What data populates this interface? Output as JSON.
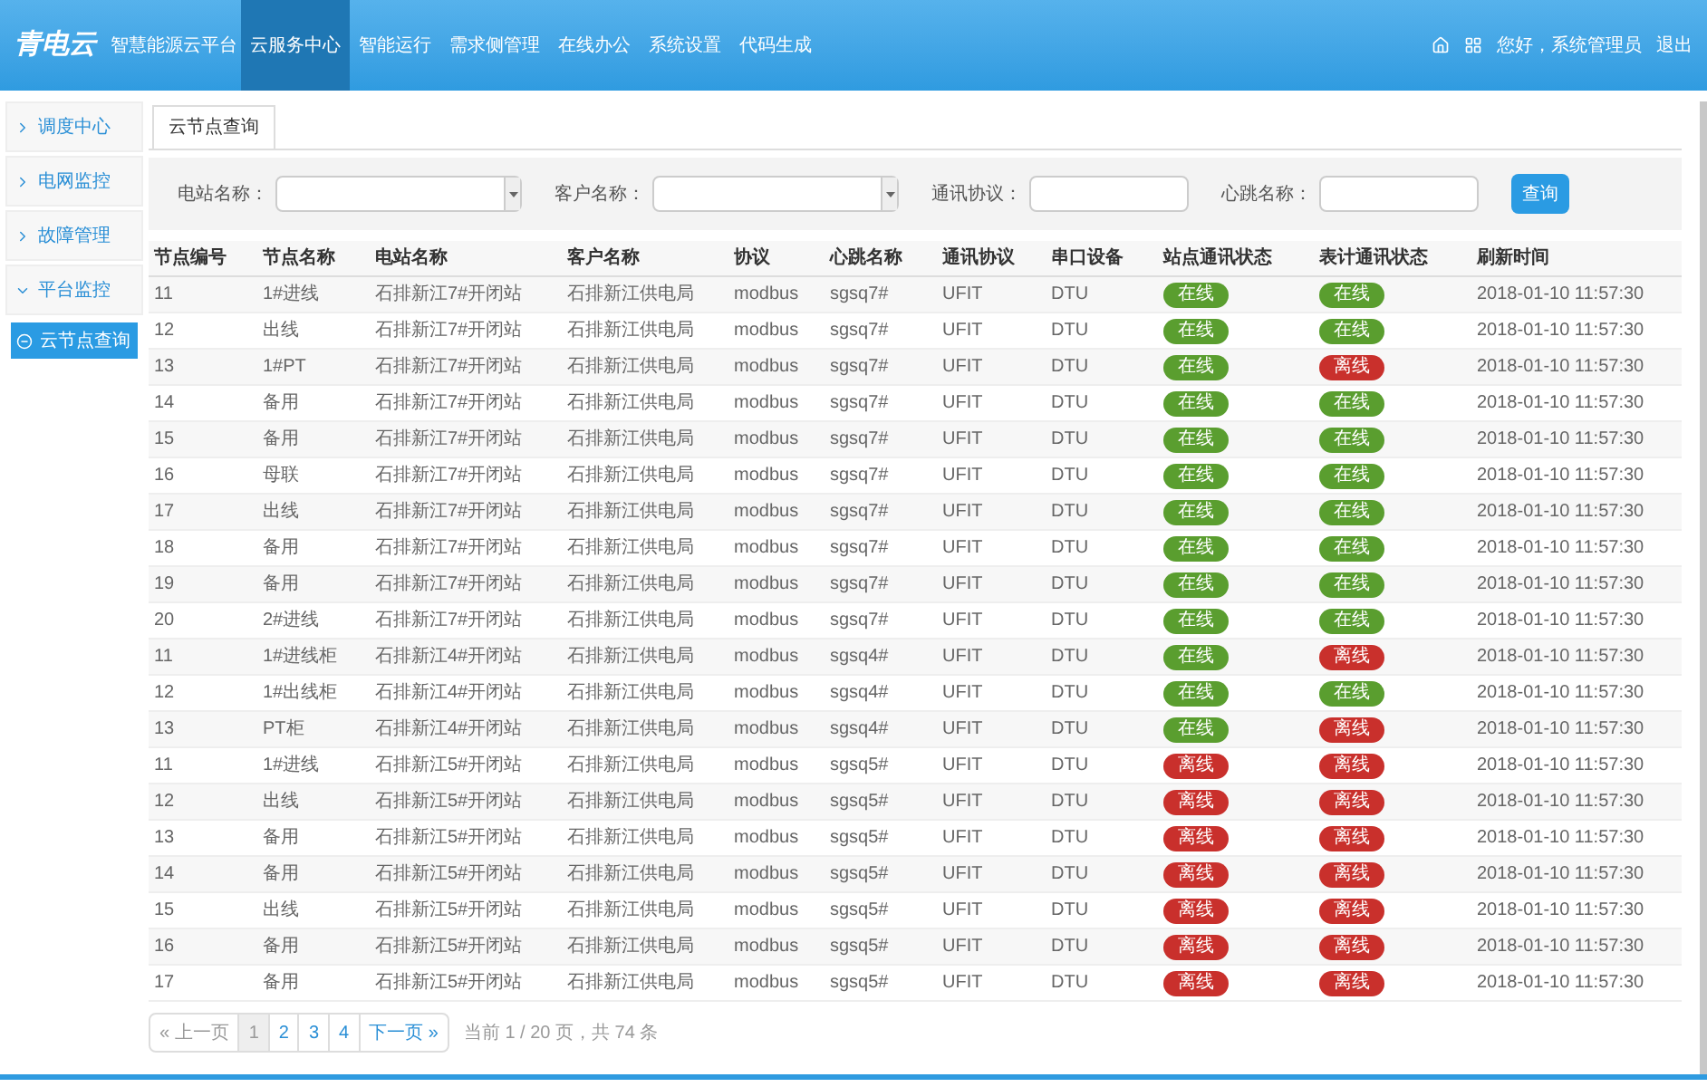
{
  "header": {
    "logo": "青电云",
    "title": "智慧能源云平台",
    "nav": [
      {
        "label": "云服务中心",
        "selected": true
      },
      {
        "label": "智能运行",
        "selected": false
      },
      {
        "label": "需求侧管理",
        "selected": false
      },
      {
        "label": "在线办公",
        "selected": false
      },
      {
        "label": "系统设置",
        "selected": false
      },
      {
        "label": "代码生成",
        "selected": false
      }
    ],
    "greeting": "您好，系统管理员",
    "logout": "退出"
  },
  "sidebar": {
    "items": [
      {
        "label": "调度中心",
        "expanded": false
      },
      {
        "label": "电网监控",
        "expanded": false
      },
      {
        "label": "故障管理",
        "expanded": false
      },
      {
        "label": "平台监控",
        "expanded": true,
        "children": [
          {
            "label": "云节点查询",
            "selected": true
          }
        ]
      }
    ]
  },
  "tabs": [
    {
      "label": "云节点查询",
      "selected": true
    }
  ],
  "filters": [
    {
      "label": "电站名称：",
      "kind": "select"
    },
    {
      "label": "客户名称：",
      "kind": "select"
    },
    {
      "label": "通讯协议：",
      "kind": "text"
    },
    {
      "label": "心跳名称：",
      "kind": "text"
    }
  ],
  "search_button": "查询",
  "table": {
    "columns": [
      "节点编号",
      "节点名称",
      "电站名称",
      "客户名称",
      "协议",
      "心跳名称",
      "通讯协议",
      "串口设备",
      "站点通讯状态",
      "表计通讯状态",
      "刷新时间"
    ],
    "rows": [
      {
        "id": "11",
        "node": "1#进线",
        "station": "石排新江7#开闭站",
        "customer": "石排新江供电局",
        "protocol": "modbus",
        "heartbeat": "sgsq7#",
        "comm": "UFIT",
        "serial": "DTU",
        "site": {
          "label": "在线",
          "online": true
        },
        "meter": {
          "label": "在线",
          "online": true
        },
        "time": "2018-01-10 11:57:30"
      },
      {
        "id": "12",
        "node": "出线",
        "station": "石排新江7#开闭站",
        "customer": "石排新江供电局",
        "protocol": "modbus",
        "heartbeat": "sgsq7#",
        "comm": "UFIT",
        "serial": "DTU",
        "site": {
          "label": "在线",
          "online": true
        },
        "meter": {
          "label": "在线",
          "online": true
        },
        "time": "2018-01-10 11:57:30"
      },
      {
        "id": "13",
        "node": "1#PT",
        "station": "石排新江7#开闭站",
        "customer": "石排新江供电局",
        "protocol": "modbus",
        "heartbeat": "sgsq7#",
        "comm": "UFIT",
        "serial": "DTU",
        "site": {
          "label": "在线",
          "online": true
        },
        "meter": {
          "label": "离线",
          "online": false
        },
        "time": "2018-01-10 11:57:30"
      },
      {
        "id": "14",
        "node": "备用",
        "station": "石排新江7#开闭站",
        "customer": "石排新江供电局",
        "protocol": "modbus",
        "heartbeat": "sgsq7#",
        "comm": "UFIT",
        "serial": "DTU",
        "site": {
          "label": "在线",
          "online": true
        },
        "meter": {
          "label": "在线",
          "online": true
        },
        "time": "2018-01-10 11:57:30"
      },
      {
        "id": "15",
        "node": "备用",
        "station": "石排新江7#开闭站",
        "customer": "石排新江供电局",
        "protocol": "modbus",
        "heartbeat": "sgsq7#",
        "comm": "UFIT",
        "serial": "DTU",
        "site": {
          "label": "在线",
          "online": true
        },
        "meter": {
          "label": "在线",
          "online": true
        },
        "time": "2018-01-10 11:57:30"
      },
      {
        "id": "16",
        "node": "母联",
        "station": "石排新江7#开闭站",
        "customer": "石排新江供电局",
        "protocol": "modbus",
        "heartbeat": "sgsq7#",
        "comm": "UFIT",
        "serial": "DTU",
        "site": {
          "label": "在线",
          "online": true
        },
        "meter": {
          "label": "在线",
          "online": true
        },
        "time": "2018-01-10 11:57:30"
      },
      {
        "id": "17",
        "node": "出线",
        "station": "石排新江7#开闭站",
        "customer": "石排新江供电局",
        "protocol": "modbus",
        "heartbeat": "sgsq7#",
        "comm": "UFIT",
        "serial": "DTU",
        "site": {
          "label": "在线",
          "online": true
        },
        "meter": {
          "label": "在线",
          "online": true
        },
        "time": "2018-01-10 11:57:30"
      },
      {
        "id": "18",
        "node": "备用",
        "station": "石排新江7#开闭站",
        "customer": "石排新江供电局",
        "protocol": "modbus",
        "heartbeat": "sgsq7#",
        "comm": "UFIT",
        "serial": "DTU",
        "site": {
          "label": "在线",
          "online": true
        },
        "meter": {
          "label": "在线",
          "online": true
        },
        "time": "2018-01-10 11:57:30"
      },
      {
        "id": "19",
        "node": "备用",
        "station": "石排新江7#开闭站",
        "customer": "石排新江供电局",
        "protocol": "modbus",
        "heartbeat": "sgsq7#",
        "comm": "UFIT",
        "serial": "DTU",
        "site": {
          "label": "在线",
          "online": true
        },
        "meter": {
          "label": "在线",
          "online": true
        },
        "time": "2018-01-10 11:57:30"
      },
      {
        "id": "20",
        "node": "2#进线",
        "station": "石排新江7#开闭站",
        "customer": "石排新江供电局",
        "protocol": "modbus",
        "heartbeat": "sgsq7#",
        "comm": "UFIT",
        "serial": "DTU",
        "site": {
          "label": "在线",
          "online": true
        },
        "meter": {
          "label": "在线",
          "online": true
        },
        "time": "2018-01-10 11:57:30"
      },
      {
        "id": "11",
        "node": "1#进线柜",
        "station": "石排新江4#开闭站",
        "customer": "石排新江供电局",
        "protocol": "modbus",
        "heartbeat": "sgsq4#",
        "comm": "UFIT",
        "serial": "DTU",
        "site": {
          "label": "在线",
          "online": true
        },
        "meter": {
          "label": "离线",
          "online": false
        },
        "time": "2018-01-10 11:57:30"
      },
      {
        "id": "12",
        "node": "1#出线柜",
        "station": "石排新江4#开闭站",
        "customer": "石排新江供电局",
        "protocol": "modbus",
        "heartbeat": "sgsq4#",
        "comm": "UFIT",
        "serial": "DTU",
        "site": {
          "label": "在线",
          "online": true
        },
        "meter": {
          "label": "在线",
          "online": true
        },
        "time": "2018-01-10 11:57:30"
      },
      {
        "id": "13",
        "node": "PT柜",
        "station": "石排新江4#开闭站",
        "customer": "石排新江供电局",
        "protocol": "modbus",
        "heartbeat": "sgsq4#",
        "comm": "UFIT",
        "serial": "DTU",
        "site": {
          "label": "在线",
          "online": true
        },
        "meter": {
          "label": "离线",
          "online": false
        },
        "time": "2018-01-10 11:57:30"
      },
      {
        "id": "11",
        "node": "1#进线",
        "station": "石排新江5#开闭站",
        "customer": "石排新江供电局",
        "protocol": "modbus",
        "heartbeat": "sgsq5#",
        "comm": "UFIT",
        "serial": "DTU",
        "site": {
          "label": "离线",
          "online": false
        },
        "meter": {
          "label": "离线",
          "online": false
        },
        "time": "2018-01-10 11:57:30"
      },
      {
        "id": "12",
        "node": "出线",
        "station": "石排新江5#开闭站",
        "customer": "石排新江供电局",
        "protocol": "modbus",
        "heartbeat": "sgsq5#",
        "comm": "UFIT",
        "serial": "DTU",
        "site": {
          "label": "离线",
          "online": false
        },
        "meter": {
          "label": "离线",
          "online": false
        },
        "time": "2018-01-10 11:57:30"
      },
      {
        "id": "13",
        "node": "备用",
        "station": "石排新江5#开闭站",
        "customer": "石排新江供电局",
        "protocol": "modbus",
        "heartbeat": "sgsq5#",
        "comm": "UFIT",
        "serial": "DTU",
        "site": {
          "label": "离线",
          "online": false
        },
        "meter": {
          "label": "离线",
          "online": false
        },
        "time": "2018-01-10 11:57:30"
      },
      {
        "id": "14",
        "node": "备用",
        "station": "石排新江5#开闭站",
        "customer": "石排新江供电局",
        "protocol": "modbus",
        "heartbeat": "sgsq5#",
        "comm": "UFIT",
        "serial": "DTU",
        "site": {
          "label": "离线",
          "online": false
        },
        "meter": {
          "label": "离线",
          "online": false
        },
        "time": "2018-01-10 11:57:30"
      },
      {
        "id": "15",
        "node": "出线",
        "station": "石排新江5#开闭站",
        "customer": "石排新江供电局",
        "protocol": "modbus",
        "heartbeat": "sgsq5#",
        "comm": "UFIT",
        "serial": "DTU",
        "site": {
          "label": "离线",
          "online": false
        },
        "meter": {
          "label": "离线",
          "online": false
        },
        "time": "2018-01-10 11:57:30"
      },
      {
        "id": "16",
        "node": "备用",
        "station": "石排新江5#开闭站",
        "customer": "石排新江供电局",
        "protocol": "modbus",
        "heartbeat": "sgsq5#",
        "comm": "UFIT",
        "serial": "DTU",
        "site": {
          "label": "离线",
          "online": false
        },
        "meter": {
          "label": "离线",
          "online": false
        },
        "time": "2018-01-10 11:57:30"
      },
      {
        "id": "17",
        "node": "备用",
        "station": "石排新江5#开闭站",
        "customer": "石排新江供电局",
        "protocol": "modbus",
        "heartbeat": "sgsq5#",
        "comm": "UFIT",
        "serial": "DTU",
        "site": {
          "label": "离线",
          "online": false
        },
        "meter": {
          "label": "离线",
          "online": false
        },
        "time": "2018-01-10 11:57:30"
      }
    ]
  },
  "pagination": {
    "prev": "« 上一页",
    "pages": [
      {
        "label": "1",
        "selected": true
      },
      {
        "label": "2",
        "selected": false
      },
      {
        "label": "3",
        "selected": false
      },
      {
        "label": "4",
        "selected": false
      }
    ],
    "next": "下一页 »",
    "summary": "当前 1 / 20 页，共 74 条"
  }
}
